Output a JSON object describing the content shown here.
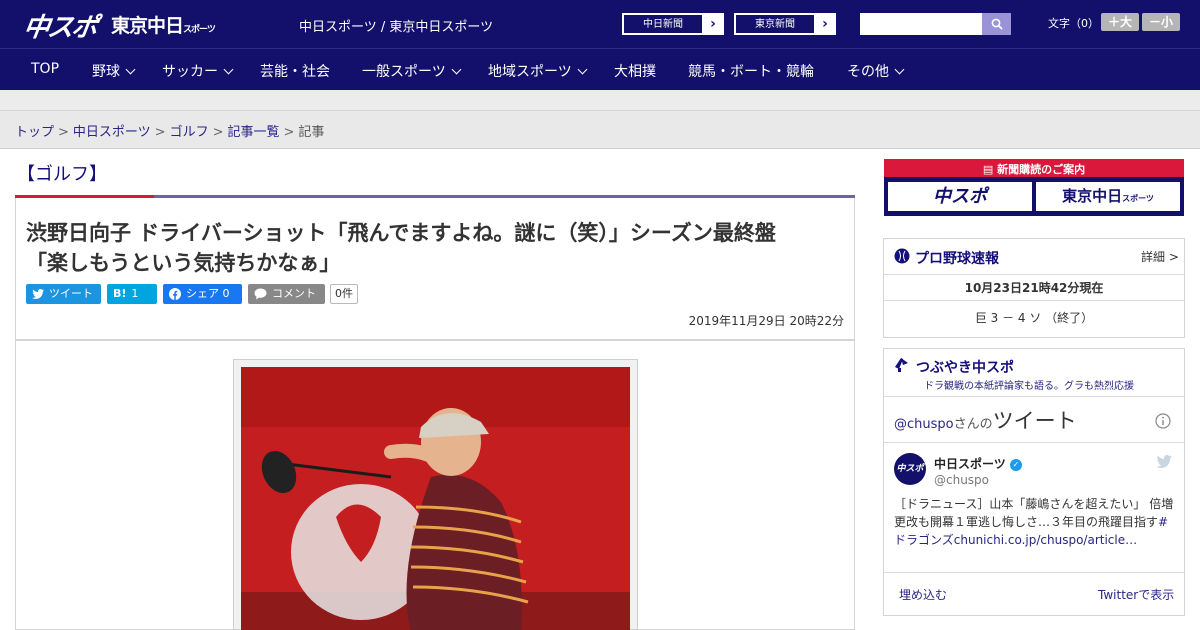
{
  "header": {
    "logo_main": "中スポ",
    "logo_tokyo": "東京中日",
    "logo_tokyo_small": "スポーツ",
    "site_names": "中日スポーツ / 東京中日スポーツ",
    "ext_links": [
      {
        "label": "中日新聞",
        "arrow": "›"
      },
      {
        "label": "東京新聞",
        "arrow": "›"
      }
    ],
    "search_placeholder": "",
    "font_size_label": "文字（0）",
    "font_plus": "＋大",
    "font_minus": "－小"
  },
  "nav": {
    "items": [
      {
        "label": "TOP",
        "has_menu": false
      },
      {
        "label": "野球",
        "has_menu": true
      },
      {
        "label": "サッカー",
        "has_menu": true
      },
      {
        "label": "芸能・社会",
        "has_menu": false
      },
      {
        "label": "一般スポーツ",
        "has_menu": true
      },
      {
        "label": "地域スポーツ",
        "has_menu": true
      },
      {
        "label": "大相撲",
        "has_menu": false
      },
      {
        "label": "競馬・ボート・競輪",
        "has_menu": false
      },
      {
        "label": "その他",
        "has_menu": true
      }
    ]
  },
  "breadcrumb": {
    "items": [
      "トップ",
      "中日スポーツ",
      "ゴルフ",
      "記事一覧"
    ],
    "current": "記事",
    "separator": ">"
  },
  "article": {
    "category": "【ゴルフ】",
    "headline_line1": "渋野日向子 ドライバーショット「飛んでますよね。謎に（笑）」シーズン最終盤",
    "headline_line2": "「楽しもうという気持ちかなぁ」",
    "share": {
      "tweet": "ツイート",
      "hatena_icon": "B!",
      "hatena_count": "1",
      "facebook": "シェア 0",
      "comment": "コメント",
      "comment_count": "0件"
    },
    "date": "2019年11月29日 20時22分"
  },
  "sidebar": {
    "ad_title": "新聞購読のご案内",
    "ad_logo_1": "中スポ",
    "ad_logo_2": "東京中日",
    "ad_logo_2_small": "スポーツ",
    "baseball": {
      "title": "プロ野球速報",
      "detail": "詳細 >",
      "timestamp": "10月23日21時42分現在",
      "score": "巨 3 － 4 ソ （終了）"
    },
    "tsubuyaki": {
      "title": "つぶやき中スポ",
      "subtitle": "ドラ観戦の本紙評論家も語る。グラも熱烈応援",
      "handle_prefix": "@chuspo",
      "handle_suffix": "さんの",
      "tweets_label": "ツイート",
      "account_name": "中日スポーツ",
      "account_handle": "@chuspo",
      "avatar_text": "中スポ",
      "tweet_text": "［ドラニュース］山本「藤嶋さんを超えたい」 倍増更改も開幕１軍逃し悔しさ…３年目の飛躍目指す",
      "tweet_hashtag": "#ドラゴンズ",
      "tweet_link": "chunichi.co.jp/chuspo/article…",
      "embed_label": "埋め込む",
      "view_label": "Twitterで表示"
    }
  },
  "colors": {
    "navy": "#12106a",
    "red": "#d9183b",
    "twitter": "#1b95e0",
    "hatena": "#00a4de",
    "facebook": "#1877f2",
    "comment": "#888888"
  }
}
